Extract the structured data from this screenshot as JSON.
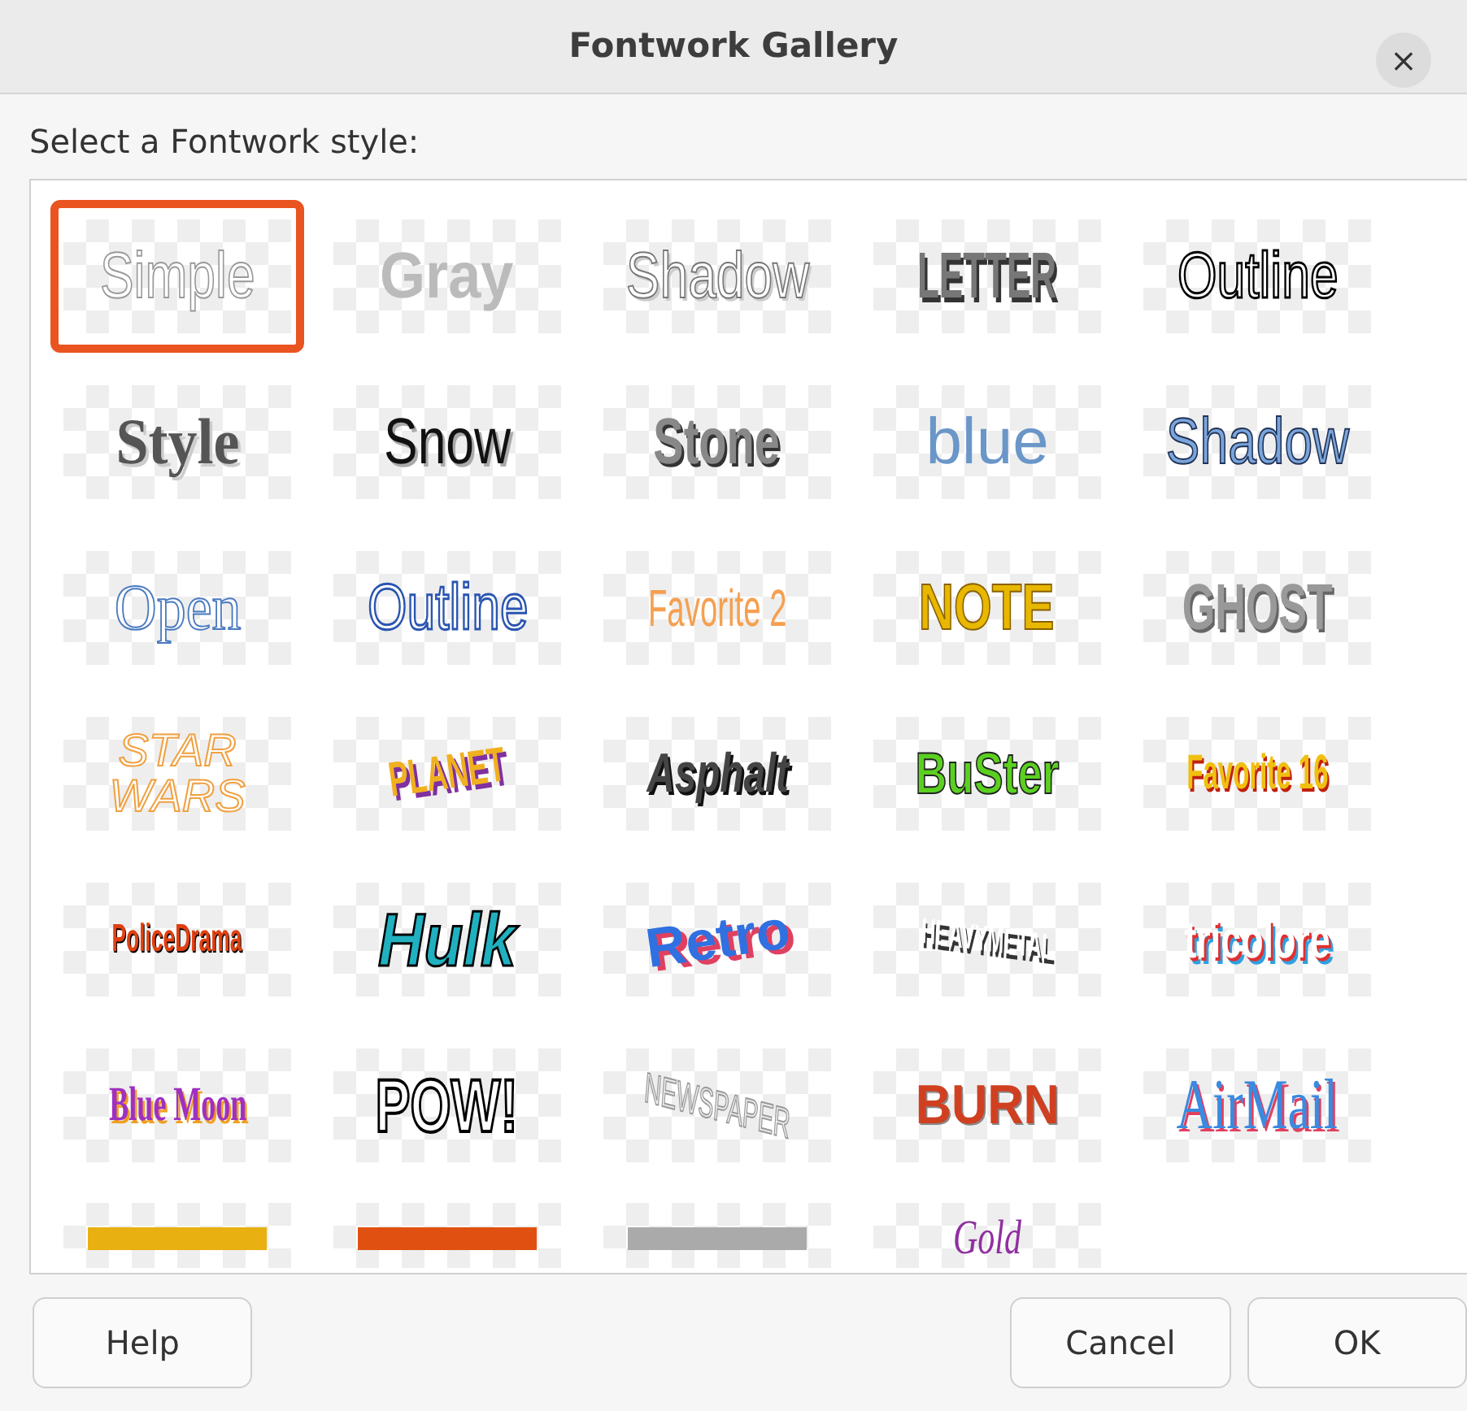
{
  "window": {
    "title": "Fontwork Gallery",
    "close": "×"
  },
  "prompt": "Select a Fontwork style:",
  "styles": [
    {
      "label": "Simple",
      "selected": true
    },
    {
      "label": "Gray",
      "selected": false
    },
    {
      "label": "Shadow",
      "selected": false
    },
    {
      "label": "LETTER",
      "selected": false
    },
    {
      "label": "Outline",
      "selected": false
    },
    {
      "label": "Style",
      "selected": false
    },
    {
      "label": "Snow",
      "selected": false
    },
    {
      "label": "Stone",
      "selected": false
    },
    {
      "label": "blue",
      "selected": false
    },
    {
      "label": "Shadow",
      "selected": false
    },
    {
      "label": "Open",
      "selected": false
    },
    {
      "label": "Outline",
      "selected": false
    },
    {
      "label": "Favorite 2",
      "selected": false
    },
    {
      "label": "NOTE",
      "selected": false
    },
    {
      "label": "GHOST",
      "selected": false
    },
    {
      "label": "STAR WARS",
      "selected": false
    },
    {
      "label": "PLANET",
      "selected": false
    },
    {
      "label": "Asphalt",
      "selected": false
    },
    {
      "label": "BuSter",
      "selected": false
    },
    {
      "label": "Favorite 16",
      "selected": false
    },
    {
      "label": "PoliceDrama",
      "selected": false
    },
    {
      "label": "Hulk",
      "selected": false
    },
    {
      "label": "Retro",
      "selected": false
    },
    {
      "label": "HEAVYMETAL",
      "selected": false
    },
    {
      "label": "tricolore",
      "selected": false
    },
    {
      "label": "Blue Moon",
      "selected": false
    },
    {
      "label": "POW!",
      "selected": false
    },
    {
      "label": "NEWSPAPER",
      "selected": false
    },
    {
      "label": "BURN",
      "selected": false
    },
    {
      "label": "AirMail",
      "selected": false
    },
    {
      "selected": false
    },
    {
      "selected": false
    },
    {
      "selected": false
    },
    {
      "label": "Gold",
      "selected": false
    }
  ],
  "buttons": {
    "help": "Help",
    "cancel": "Cancel",
    "ok": "OK"
  }
}
